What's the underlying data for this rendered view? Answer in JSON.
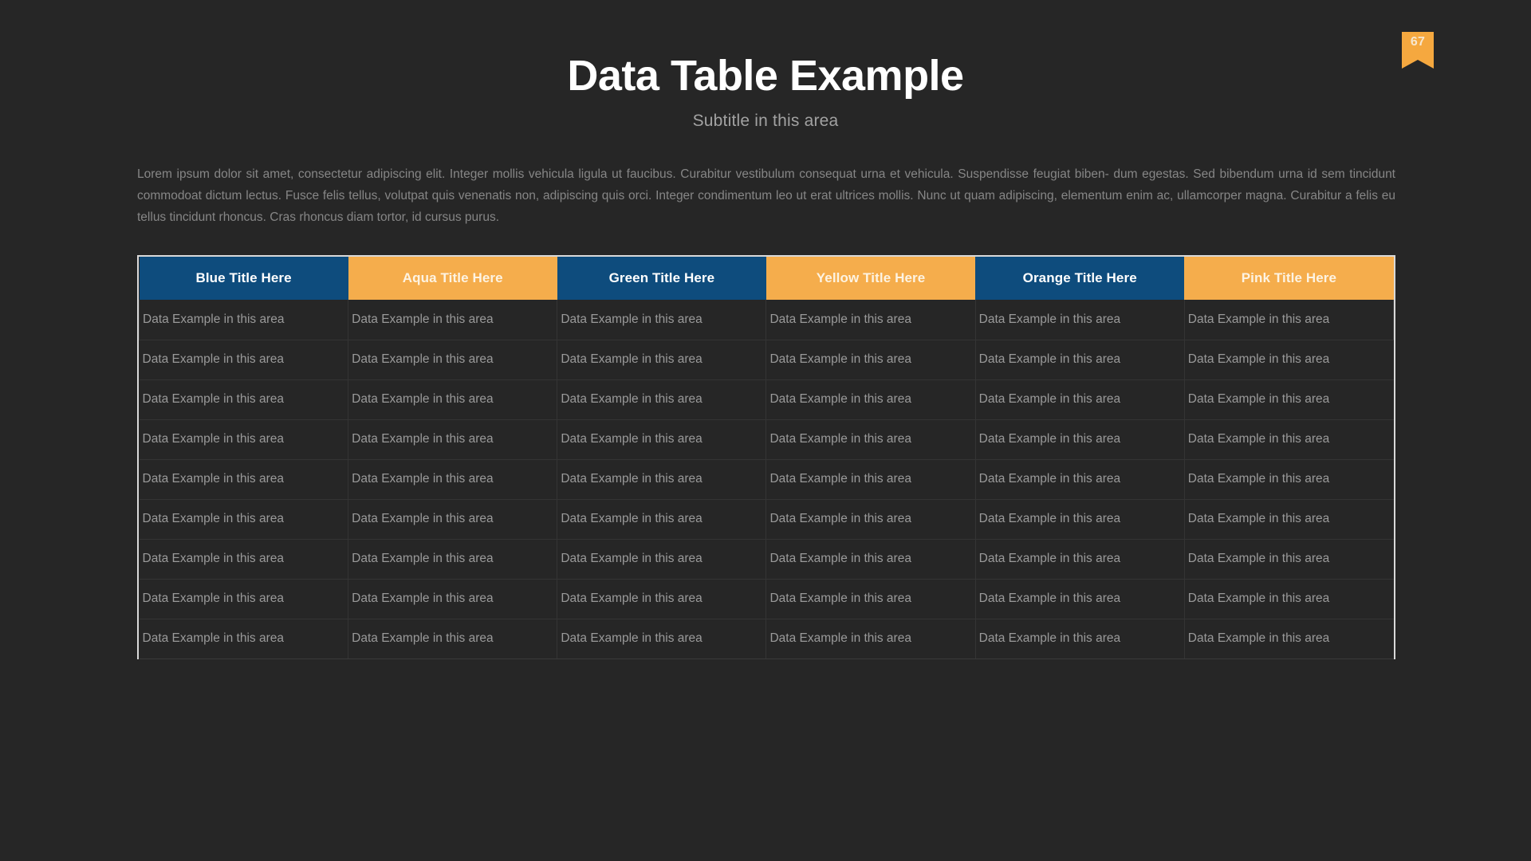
{
  "page": {
    "background_color": "#262626",
    "badge": {
      "number": "67",
      "color": "#f5a83f",
      "icon": "bookmark-ribbon-icon"
    }
  },
  "header": {
    "title": "Data Table Example",
    "subtitle": "Subtitle in this area"
  },
  "body": {
    "paragraph": "Lorem ipsum dolor sit amet, consectetur adipiscing elit. Integer mollis vehicula ligula ut faucibus. Curabitur vestibulum consequat urna et vehicula. Suspendisse feugiat biben- dum egestas. Sed bibendum urna id sem tincidunt commodoat dictum lectus. Fusce felis tellus, volutpat quis venenatis non, adipiscing quis orci. Integer condimentum leo ut erat ultrices mollis. Nunc ut quam adipiscing, elementum enim ac, ullamcorper magna. Curabitur a felis eu tellus tincidunt rhoncus. Cras rhoncus diam tortor, id cursus purus."
  },
  "table": {
    "colors": {
      "header_dark": "#0e4c7d",
      "header_amber": "#f5ad4c",
      "frame": "#d9d9d9",
      "cell_text": "#9a9a9a",
      "divider": "#343434"
    },
    "headers": [
      {
        "label": "Blue Title Here",
        "style": "dark"
      },
      {
        "label": "Aqua Title Here",
        "style": "amber"
      },
      {
        "label": "Green Title Here",
        "style": "dark"
      },
      {
        "label": "Yellow Title Here",
        "style": "amber"
      },
      {
        "label": "Orange Title Here",
        "style": "dark"
      },
      {
        "label": "Pink Title Here",
        "style": "amber"
      }
    ],
    "cell_text": "Data Example in this area",
    "rows": [
      [
        "Data Example in this area",
        "Data Example in this area",
        "Data Example in this area",
        "Data Example in this area",
        "Data Example in this area",
        "Data Example in this area"
      ],
      [
        "Data Example in this area",
        "Data Example in this area",
        "Data Example in this area",
        "Data Example in this area",
        "Data Example in this area",
        "Data Example in this area"
      ],
      [
        "Data Example in this area",
        "Data Example in this area",
        "Data Example in this area",
        "Data Example in this area",
        "Data Example in this area",
        "Data Example in this area"
      ],
      [
        "Data Example in this area",
        "Data Example in this area",
        "Data Example in this area",
        "Data Example in this area",
        "Data Example in this area",
        "Data Example in this area"
      ],
      [
        "Data Example in this area",
        "Data Example in this area",
        "Data Example in this area",
        "Data Example in this area",
        "Data Example in this area",
        "Data Example in this area"
      ],
      [
        "Data Example in this area",
        "Data Example in this area",
        "Data Example in this area",
        "Data Example in this area",
        "Data Example in this area",
        "Data Example in this area"
      ],
      [
        "Data Example in this area",
        "Data Example in this area",
        "Data Example in this area",
        "Data Example in this area",
        "Data Example in this area",
        "Data Example in this area"
      ],
      [
        "Data Example in this area",
        "Data Example in this area",
        "Data Example in this area",
        "Data Example in this area",
        "Data Example in this area",
        "Data Example in this area"
      ],
      [
        "Data Example in this area",
        "Data Example in this area",
        "Data Example in this area",
        "Data Example in this area",
        "Data Example in this area",
        "Data Example in this area"
      ]
    ]
  }
}
